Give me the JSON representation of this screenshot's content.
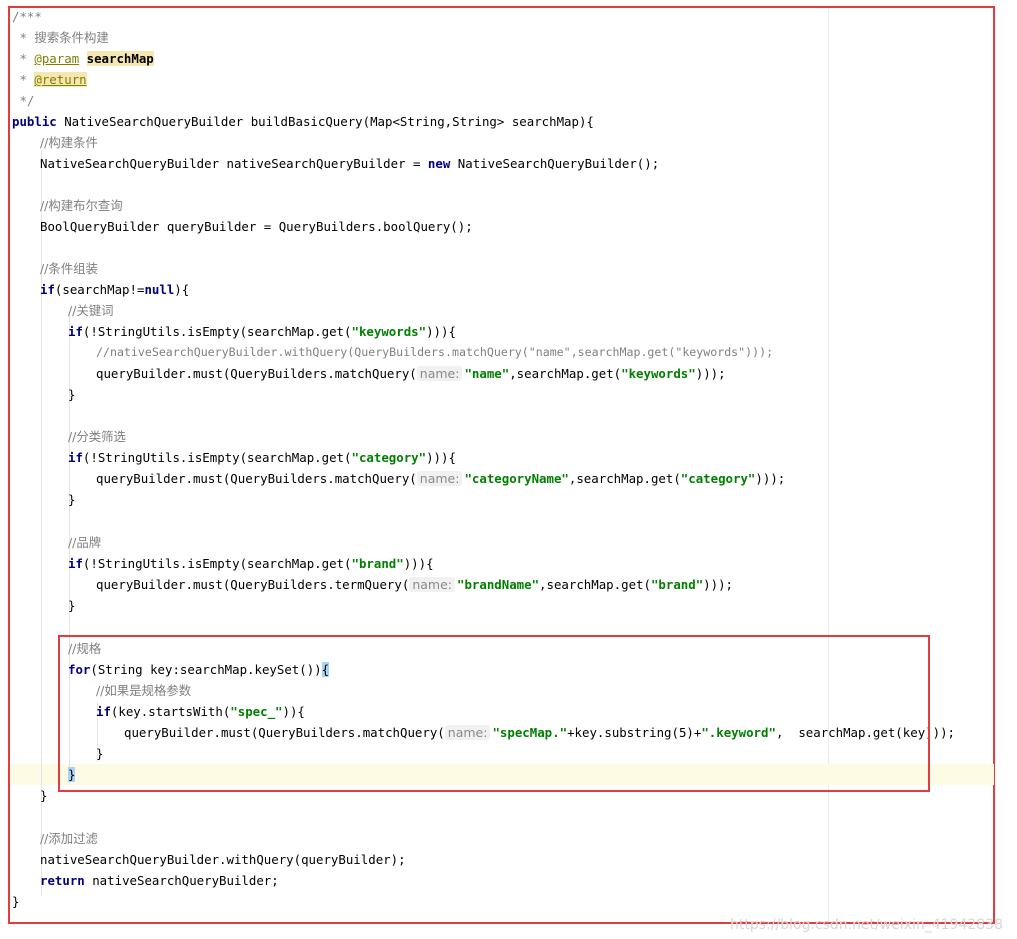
{
  "editor": {
    "javadoc": {
      "open": "/***",
      "desc_prefix": " * ",
      "desc": "搜索条件构建",
      "param_prefix": " * ",
      "param_tag": "@param",
      "param_name": "searchMap",
      "return_prefix": " * ",
      "return_tag": "@return",
      "close": " */"
    },
    "method": {
      "modifier": "public",
      "signature": " NativeSearchQueryBuilder buildBasicQuery(Map<String,String> searchMap){"
    },
    "comment_build": "//构建条件",
    "native_decl_a": "NativeSearchQueryBuilder nativeSearchQueryBuilder = ",
    "kw_new": "new",
    "native_decl_b": " NativeSearchQueryBuilder();",
    "comment_bool": "//构建布尔查询",
    "bool_decl": "BoolQueryBuilder queryBuilder = QueryBuilders.boolQuery();",
    "comment_assemble": "//条件组装",
    "kw_if": "if",
    "if_null_a": "(searchMap!=",
    "kw_null": "null",
    "if_null_b": "){",
    "comment_keyword": "//关键词",
    "if_kw_a": "(!StringUtils.isEmpty(searchMap.get(",
    "str_keywords": "\"keywords\"",
    "if_kw_b": "))){",
    "commented_out": "//nativeSearchQueryBuilder.withQuery(QueryBuilders.matchQuery(\"name\",searchMap.get(\"keywords\")));",
    "must_match_a": "queryBuilder.must(QueryBuilders.matchQuery(",
    "hint_name": "name:",
    "str_name": "\"name\"",
    "must_get_a": ",searchMap.get(",
    "close_paren3": ")));",
    "close_brace": "}",
    "comment_category": "//分类筛选",
    "str_category": "\"category\"",
    "str_categoryName": "\"categoryName\"",
    "comment_brand": "//品牌",
    "str_brand": "\"brand\"",
    "must_term_a": "queryBuilder.must(QueryBuilders.termQuery(",
    "str_brandName": "\"brandName\"",
    "comment_spec": "//规格",
    "kw_for": "for",
    "for_head": "(String key:searchMap.keySet())",
    "open_brace": "{",
    "comment_spec_param": "//如果是规格参数",
    "if_spec_a": "(key.startsWith(",
    "str_spec_prefix": "\"spec_\"",
    "if_spec_b": ")){",
    "str_specMap": "\"specMap.\"",
    "spec_mid": "+key.substring(5)+",
    "str_keyword_suffix": "\".keyword\"",
    "spec_tail": ",  searchMap.get(key)));",
    "comment_filter": "//添加过滤",
    "with_query": "nativeSearchQueryBuilder.withQuery(queryBuilder);",
    "kw_return": "return",
    "return_tail": " nativeSearchQueryBuilder;"
  },
  "watermark": "https://blog.csdn.net/weixin_41942838",
  "colors": {
    "keyword": "#000080",
    "string": "#008000",
    "comment": "#808080",
    "annotation": "#808000",
    "frame": "#e23c3c"
  }
}
